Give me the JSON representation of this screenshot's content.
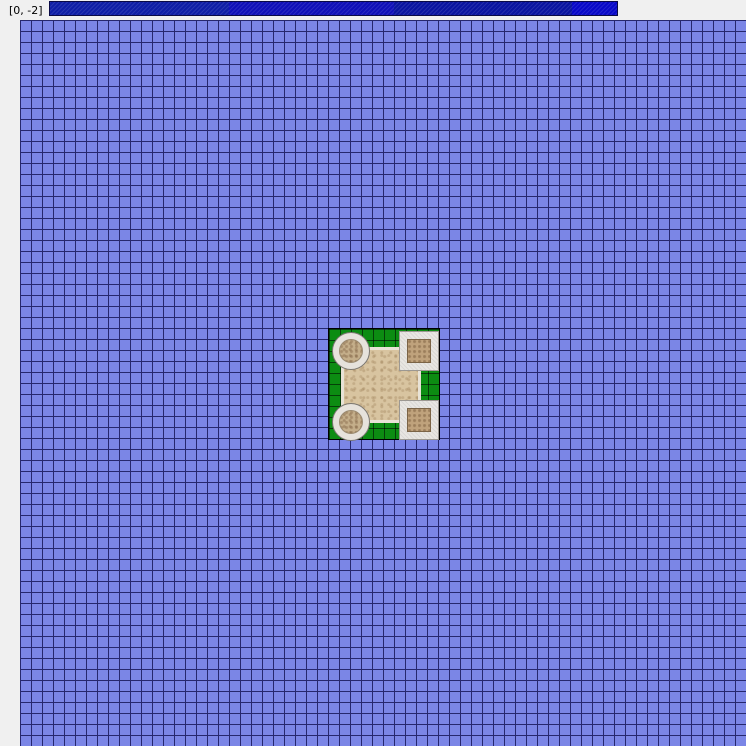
{
  "header": {
    "coordinates": "[0, -2]"
  },
  "colors": {
    "map_tile": "#7b86e6",
    "grid_line": "#26286e",
    "grass": "#0c8c12",
    "floor": "#d8c4a0",
    "progress_bar": "#14148a"
  },
  "icons": {
    "base": "castle-base-icon",
    "tower": "round-tower-icon",
    "block": "square-block-icon"
  }
}
